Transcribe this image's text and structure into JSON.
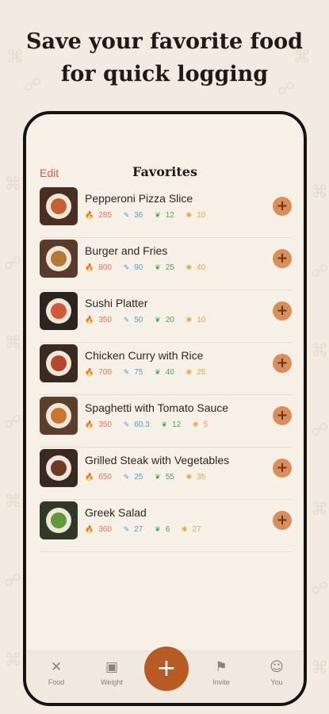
{
  "headline": {
    "line1": "Save your favorite food",
    "line2": "for quick logging"
  },
  "nav": {
    "edit_label": "Edit",
    "title": "Favorites"
  },
  "items": [
    {
      "name": "Pepperoni Pizza Slice",
      "calories": "285",
      "protein": "36",
      "fat": "12",
      "carbs": "10"
    },
    {
      "name": "Burger and Fries",
      "calories": "800",
      "protein": "90",
      "fat": "25",
      "carbs": "40"
    },
    {
      "name": "Sushi Platter",
      "calories": "350",
      "protein": "50",
      "fat": "20",
      "carbs": "10"
    },
    {
      "name": "Chicken Curry with Rice",
      "calories": "700",
      "protein": "75",
      "fat": "40",
      "carbs": "25"
    },
    {
      "name": "Spaghetti with Tomato Sauce",
      "calories": "350",
      "protein": "60.3",
      "fat": "12",
      "carbs": "5"
    },
    {
      "name": "Grilled Steak with Vegetables",
      "calories": "650",
      "protein": "25",
      "fat": "55",
      "carbs": "35"
    },
    {
      "name": "Greek Salad",
      "calories": "360",
      "protein": "27",
      "fat": "6",
      "carbs": "27"
    }
  ],
  "tabs": [
    {
      "label": "Food",
      "icon": "utensils-icon"
    },
    {
      "label": "Weight",
      "icon": "scale-icon"
    },
    {
      "label": "Invite",
      "icon": "share-icon"
    },
    {
      "label": "You",
      "icon": "person-icon"
    }
  ],
  "colors": {
    "accent": "#e0583b",
    "add_button": "#d98e5b",
    "fab": "#b85a23",
    "calories": "#e8754d",
    "protein": "#4aa3d8",
    "fat": "#3fae4a",
    "carbs": "#eaa53c"
  }
}
